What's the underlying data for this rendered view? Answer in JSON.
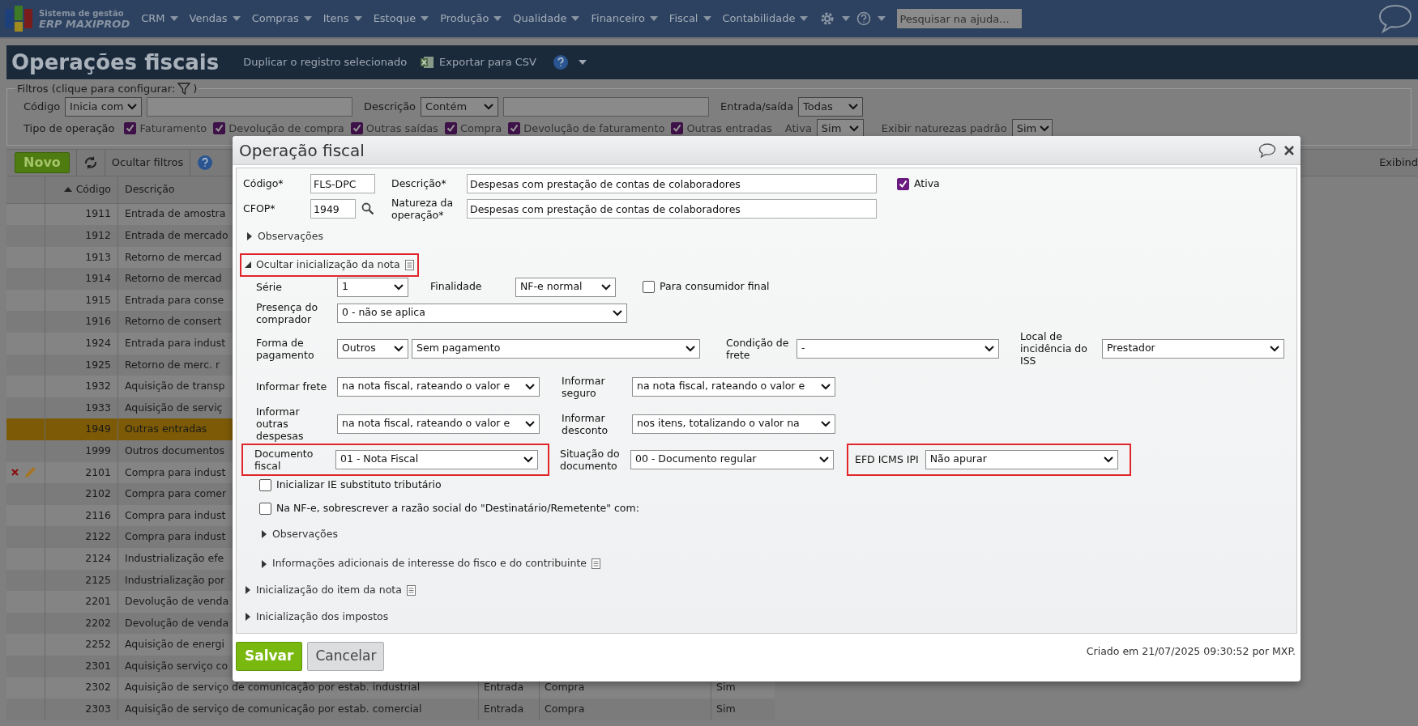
{
  "topbar": {
    "logo": [
      "Sistema de gestão",
      "ERP MAXIPROD"
    ],
    "menu": [
      "CRM",
      "Vendas",
      "Compras",
      "Itens",
      "Estoque",
      "Produção",
      "Qualidade",
      "Financeiro",
      "Fiscal",
      "Contabilidade"
    ],
    "search": {
      "placeholder": "Pesquisar na ajuda..."
    }
  },
  "header": {
    "title": "Operações fiscais",
    "actions": [
      "Duplicar o registro selecionado",
      "Exportar para CSV"
    ]
  },
  "filters": {
    "legend": "Filtros (clique para configurar:",
    "legend_end": ")",
    "row1": [
      {
        "label": "Código",
        "operator": "Inicia com"
      },
      {
        "label": "Descrição",
        "operator": "Contém"
      },
      {
        "label": "Entrada/saída",
        "operator": "Todas"
      }
    ],
    "operation_label": "Tipo de operação",
    "operation_types": [
      {
        "label": "Faturamento",
        "checked": true
      },
      {
        "label": "Devolução de compra",
        "checked": true
      },
      {
        "label": "Outras saídas",
        "checked": true
      },
      {
        "label": "Compra",
        "checked": true
      },
      {
        "label": "Devolução de faturamento",
        "checked": true
      },
      {
        "label": "Outras entradas",
        "checked": true
      }
    ],
    "ativa": {
      "label": "Ativa",
      "value": "Sim"
    },
    "naturezas": {
      "label": "Exibir naturezas padrão",
      "value": "Sim"
    }
  },
  "toolbar": {
    "new": "Novo",
    "hide_filters": "Ocultar filtros",
    "status": "Exibind"
  },
  "table": {
    "columns": [
      "Código",
      "Descrição"
    ],
    "rows": [
      {
        "code": "1911",
        "description": "Entrada de amostra",
        "selected": false,
        "row_actions": false
      },
      {
        "code": "1912",
        "description": "Entrada de mercado",
        "selected": false,
        "row_actions": false
      },
      {
        "code": "1913",
        "description": "Retorno de mercad",
        "selected": false,
        "row_actions": false
      },
      {
        "code": "1914",
        "description": "Retorno de mercad",
        "selected": false,
        "row_actions": false
      },
      {
        "code": "1915",
        "description": "Entrada para conse",
        "selected": false,
        "row_actions": false
      },
      {
        "code": "1916",
        "description": "Retorno de consert",
        "selected": false,
        "row_actions": false
      },
      {
        "code": "1924",
        "description": "Entrada para indust",
        "selected": false,
        "row_actions": false
      },
      {
        "code": "1925",
        "description": "Retorno de merc. r",
        "selected": false,
        "row_actions": false
      },
      {
        "code": "1932",
        "description": "Aquisição de transp",
        "selected": false,
        "row_actions": false
      },
      {
        "code": "1933",
        "description": "Aquisição de serviç",
        "selected": false,
        "row_actions": false
      },
      {
        "code": "1949",
        "description": "Outras entradas",
        "selected": true,
        "row_actions": false
      },
      {
        "code": "1999",
        "description": "Outros documentos",
        "selected": false,
        "row_actions": false
      },
      {
        "code": "2101",
        "description": "Compra para indust",
        "selected": false,
        "row_actions": true
      },
      {
        "code": "2102",
        "description": "Compra para comer",
        "selected": false,
        "row_actions": false
      },
      {
        "code": "2116",
        "description": "Compra para indust",
        "selected": false,
        "row_actions": false
      },
      {
        "code": "2122",
        "description": "Compra para indust",
        "selected": false,
        "row_actions": false
      },
      {
        "code": "2124",
        "description": "Industrialização efe",
        "selected": false,
        "row_actions": false
      },
      {
        "code": "2125",
        "description": "Industrialização por",
        "selected": false,
        "row_actions": false
      },
      {
        "code": "2201",
        "description": "Devolução de venda",
        "selected": false,
        "row_actions": false
      },
      {
        "code": "2202",
        "description": "Devolução de venda",
        "selected": false,
        "row_actions": false
      },
      {
        "code": "2252",
        "description": "Aquisição de energi",
        "selected": false,
        "row_actions": false
      },
      {
        "code": "2301",
        "description": "Aquisição serviço co",
        "selected": false,
        "row_actions": false
      },
      {
        "code": "2302",
        "description": "Aquisição de serviço de comunicação por estab. industrial",
        "entry": "Entrada",
        "type": "Compra",
        "active": "Sim",
        "selected": false,
        "row_actions": false
      },
      {
        "code": "2303",
        "description": "Aquisição de serviço de comunicação por estab. comercial",
        "entry": "Entrada",
        "type": "Compra",
        "active": "Sim",
        "selected": false,
        "row_actions": false
      }
    ]
  },
  "dialog": {
    "title": "Operação fiscal",
    "fields": {
      "codigo": {
        "label": "Código*",
        "value": "FLS-DPC"
      },
      "descricao": {
        "label": "Descrição*",
        "value": "Despesas com prestação de contas de colaboradores"
      },
      "ativa": {
        "label": "Ativa",
        "checked": true
      },
      "cfop": {
        "label": "CFOP*",
        "value": "1949"
      },
      "natureza": {
        "label": "Natureza da operação*",
        "value": "Despesas com prestação de contas de colaboradores"
      }
    },
    "observacoes": {
      "label": "Observações",
      "expanded": false
    },
    "note_init": {
      "label": "Ocultar inicialização da nota",
      "expanded": true,
      "highlighted": true,
      "serie": {
        "label": "Série",
        "value": "1"
      },
      "finalidade": {
        "label": "Finalidade",
        "value": "NF-e normal"
      },
      "consumidor_final": {
        "label": "Para consumidor final",
        "checked": false
      },
      "presenca": {
        "label": "Presença do comprador",
        "value": "0 - não se aplica"
      },
      "forma_pagamento": {
        "label": "Forma de pagamento",
        "values": [
          "Outros",
          "Sem pagamento"
        ]
      },
      "condicao_frete": {
        "label": "Condição de frete",
        "value": "-"
      },
      "local_iss": {
        "label": "Local de incidência do ISS",
        "value": "Prestador"
      },
      "frete": {
        "label": "Informar frete",
        "value": "na nota fiscal, rateando o valor e"
      },
      "seguro": {
        "label": "Informar seguro",
        "value": "na nota fiscal, rateando o valor e"
      },
      "outras_despesas": {
        "label": "Informar outras despesas",
        "value": "na nota fiscal, rateando o valor e"
      },
      "desconto": {
        "label": "Informar desconto",
        "value": "nos itens, totalizando o valor na"
      },
      "documento_fiscal": {
        "label": "Documento fiscal",
        "value": "01 - Nota Fiscal",
        "highlighted": true
      },
      "situacao": {
        "label": "Situação do documento",
        "value": "00 - Documento regular"
      },
      "efd": {
        "label": "EFD ICMS IPI",
        "value": "Não apurar",
        "highlighted": true
      },
      "checkboxes": [
        {
          "label": "Inicializar IE substituto tributário",
          "checked": false
        },
        {
          "label": "Na NF-e, sobrescrever a razão social do \"Destinatário/Remetente\" com:",
          "checked": false
        }
      ],
      "subsections": [
        {
          "label": "Observações",
          "expanded": false,
          "has_doc": false
        },
        {
          "label": "Informações adicionais de interesse do fisco e do contribuinte",
          "expanded": false,
          "has_doc": true
        }
      ]
    },
    "sections": [
      {
        "label": "Inicialização do item da nota",
        "expanded": false,
        "has_doc": true
      },
      {
        "label": "Inicialização dos impostos",
        "expanded": false,
        "has_doc": false
      }
    ],
    "buttons": {
      "save": "Salvar",
      "cancel": "Cancelar"
    },
    "footer": "Criado em 21/07/2025 09:30:52 por MXP."
  }
}
